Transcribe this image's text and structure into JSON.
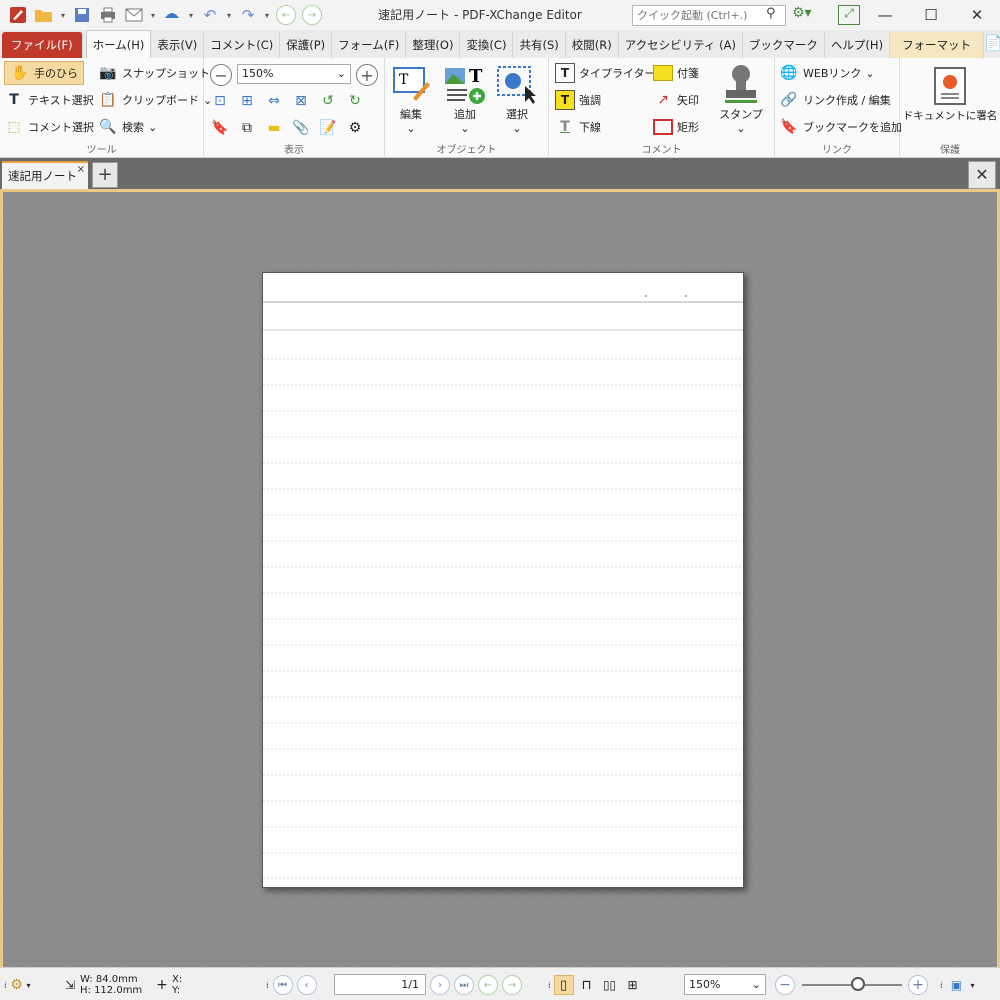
{
  "window": {
    "title": "速記用ノート - PDF-XChange Editor",
    "quick_launch_placeholder": "クイック起動 (Ctrl+.)",
    "minimize": "—",
    "maximize": "☐",
    "close": "✕"
  },
  "menu": {
    "tabs": [
      "ファイル(F)",
      "ホーム(H)",
      "表示(V)",
      "コメント(C)",
      "保護(P)",
      "フォーム(F)",
      "整理(O)",
      "変換(C)",
      "共有(S)",
      "校閲(R)",
      "アクセシビリティ (A)",
      "ブックマーク",
      "ヘルプ(H)",
      "フォーマット"
    ],
    "active": "ホーム(H)"
  },
  "ribbon": {
    "tools": {
      "label": "ツール",
      "hand": "手のひら",
      "snapshot": "スナップショット",
      "text_select": "テキスト選択",
      "clipboard": "クリップボード",
      "comment_select": "コメント選択",
      "search": "検索"
    },
    "view": {
      "label": "表示",
      "zoom": "150%"
    },
    "objects": {
      "label": "オブジェクト",
      "edit": "編集",
      "add": "追加",
      "select": "選択"
    },
    "comment": {
      "label": "コメント",
      "typewriter": "タイプライター",
      "sticky": "付箋",
      "highlight": "強調",
      "arrow": "矢印",
      "underline": "下線",
      "rect": "矩形",
      "stamp": "スタンプ"
    },
    "link": {
      "label": "リンク",
      "web_link": "WEBリンク",
      "create_link": "リンク作成 / 編集",
      "add_bookmark": "ブックマークを追加"
    },
    "protect": {
      "label": "保護",
      "sign": "ドキュメントに署名"
    }
  },
  "document": {
    "tab_title": "速記用ノート",
    "tab_close": "×",
    "add_tab": "+",
    "close_doc": "✕"
  },
  "status": {
    "w": "W:  84.0mm",
    "h": "H: 112.0mm",
    "x": "X:",
    "y": "Y:",
    "page": "1/1",
    "zoom": "150%"
  }
}
